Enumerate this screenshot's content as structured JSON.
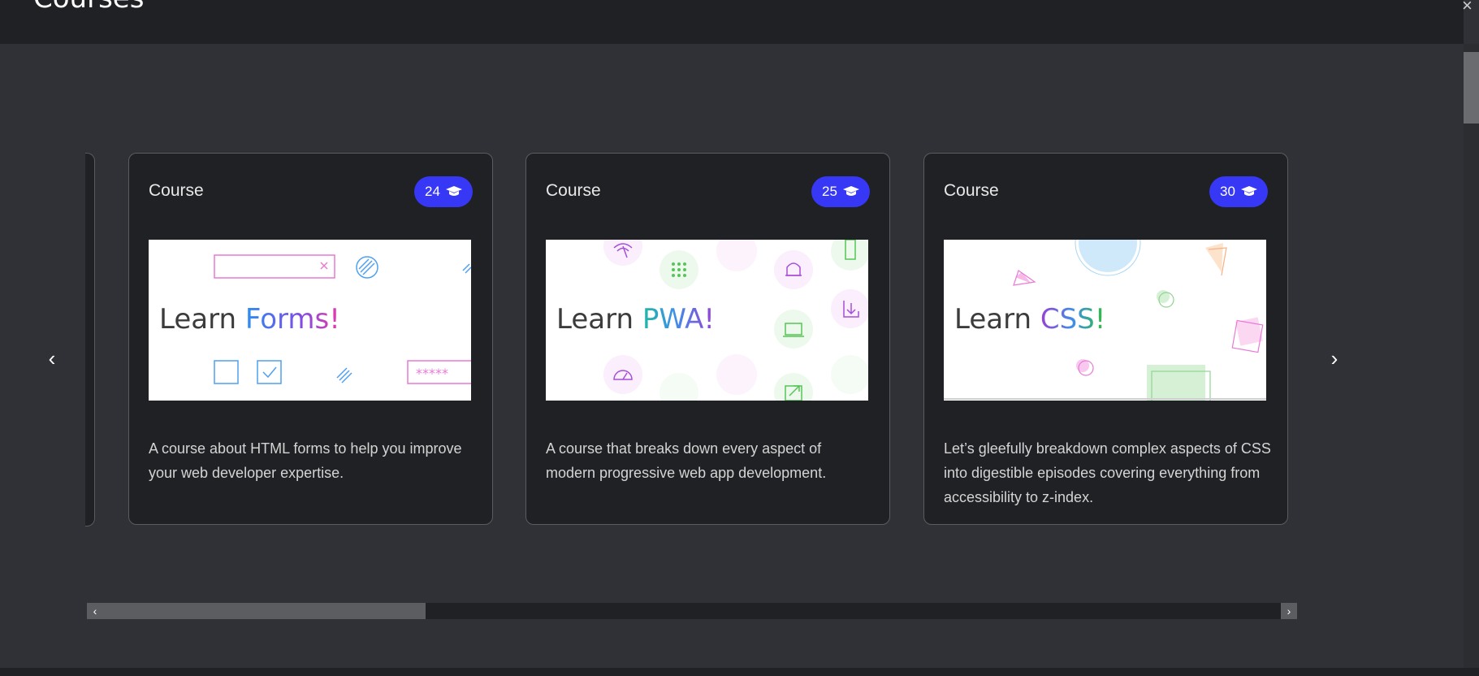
{
  "header": {
    "title": "Courses",
    "close": "×"
  },
  "carousel": {
    "prev": "‹",
    "next": "›",
    "cards": [
      {
        "kicker": "Course",
        "count": "24",
        "learn_word": "Learn",
        "topic": "Forms!",
        "description": "A course about HTML forms to help you improve your web developer expertise.",
        "password_mask": "*****"
      },
      {
        "kicker": "Course",
        "count": "25",
        "learn_word": "Learn",
        "topic": "PWA!",
        "description": "A course that breaks down every aspect of modern progressive web app development."
      },
      {
        "kicker": "Course",
        "count": "30",
        "learn_word": "Learn",
        "topic": "CSS!",
        "description": "Let’s gleefully breakdown complex aspects of CSS into digestible episodes covering everything from accessibility to z-index."
      }
    ]
  },
  "scrollbar": {
    "left": "‹",
    "right": "›"
  },
  "colors": {
    "badge": "#3738f5",
    "page_bg": "#303136",
    "card_bg": "#202124"
  },
  "icons": {
    "badge_icon": "graduation-cap-icon"
  }
}
